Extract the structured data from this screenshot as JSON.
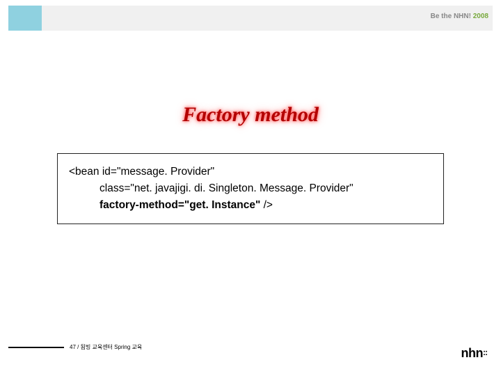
{
  "header": {
    "tagline_prefix": "Be the NHN!",
    "tagline_year": "2008"
  },
  "title": "Factory method",
  "code": {
    "line1": "<bean id=\"message. Provider\"",
    "line2": "class=\"net. javajigi. di. Singleton. Message. Provider\"",
    "line3_strong": "factory-method=\"get. Instance\"",
    "line3_tail": " />"
  },
  "footer": {
    "text": "47 / 됨빙 교육센터 Spring 교육"
  },
  "brand": {
    "name": "nhn",
    "dots": "::"
  }
}
